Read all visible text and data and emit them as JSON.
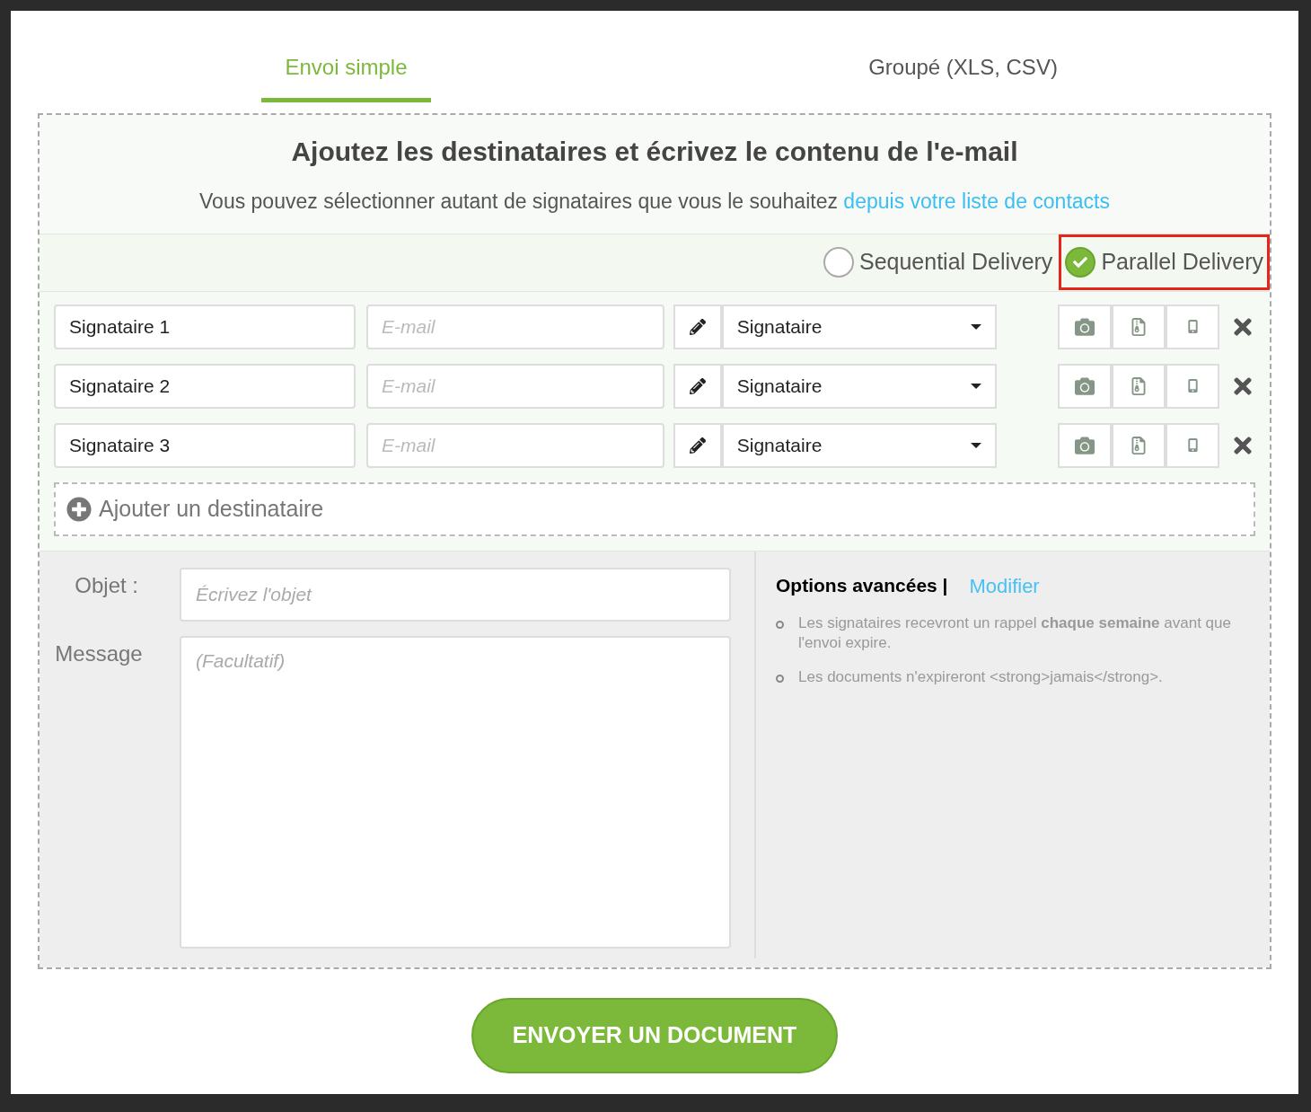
{
  "tabs": [
    {
      "label": "Envoi simple",
      "selected": true
    },
    {
      "label": "Groupé (XLS, CSV)",
      "selected": false
    }
  ],
  "heading": "Ajoutez les destinataires et écrivez le contenu de l'e-mail",
  "subtitle": {
    "text": "Vous pouvez sélectionner autant de signataires que vous le souhaitez",
    "link": "depuis votre liste de contacts"
  },
  "delivery_options": [
    {
      "label": "Sequential Delivery",
      "selected": false,
      "highlighted": false
    },
    {
      "label": "Parallel Delivery",
      "selected": true,
      "highlighted": true
    }
  ],
  "recipients": [
    {
      "name": "Signataire 1",
      "email_placeholder": "E-mail",
      "role": "Signataire"
    },
    {
      "name": "Signataire 2",
      "email_placeholder": "E-mail",
      "role": "Signataire"
    },
    {
      "name": "Signataire 3",
      "email_placeholder": "E-mail",
      "role": "Signataire"
    }
  ],
  "add_recipient": "Ajouter un destinataire",
  "subject": {
    "label": "Objet :",
    "placeholder": "Écrivez l'objet"
  },
  "message": {
    "label": "Message",
    "placeholder": "(Facultatif)"
  },
  "options": {
    "title": "Options avancées |",
    "link": "Modifier",
    "items": [
      "Les signataires recevront un rappel **chaque semaine** avant que l'envoi expire.",
      "Les documents n'expireront <strong>jamais</strong>."
    ]
  },
  "submit": "ENVOYER UN DOCUMENT"
}
